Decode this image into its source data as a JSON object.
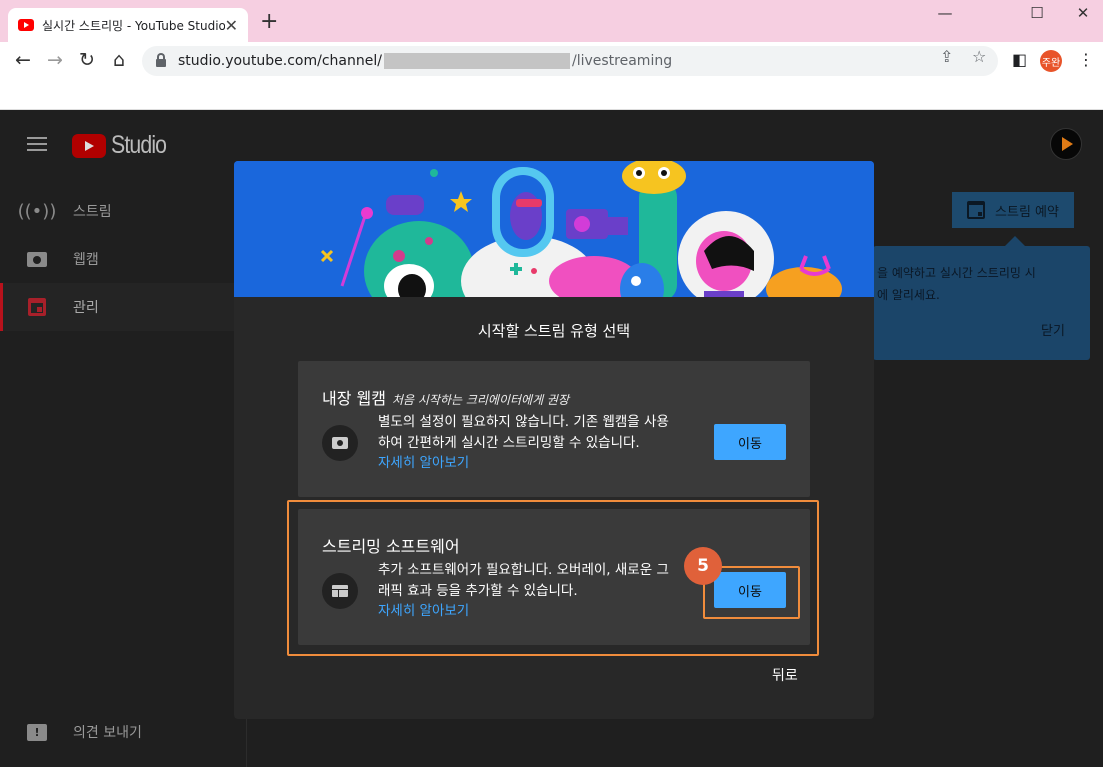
{
  "browser": {
    "tab_title": "실시간 스트리밍 - YouTube Studio",
    "tab_close": "✕",
    "new_tab": "+",
    "window_controls": {
      "minimize": "—",
      "maximize": "☐",
      "close": "✕"
    },
    "url_prefix": "studio.youtube.com/channel/",
    "url_suffix": "/livestreaming",
    "profile_label": "주완"
  },
  "studio": {
    "logo_text": "Studio",
    "sidebar": {
      "items": [
        {
          "label": "스트림",
          "icon": "live-stream-icon"
        },
        {
          "label": "웹캠",
          "icon": "camera-icon"
        },
        {
          "label": "관리",
          "icon": "calendar-icon",
          "active": true
        }
      ],
      "feedback_label": "의견 보내기"
    },
    "schedule_button": "스트림 예약",
    "tooltip": {
      "line1": "을 예약하고 실시간 스트리밍 시",
      "line2": "에 알리세요.",
      "close": "닫기"
    }
  },
  "dialog": {
    "title": "시작할 스트림 유형 선택",
    "options": [
      {
        "title": "내장 웹캠",
        "subtitle": "처음 시작하는 크리에이터에게 권장",
        "desc1": "별도의 설정이 필요하지 않습니다. 기존 웹캠을 사용",
        "desc2": "하여 간편하게 실시간 스트리밍할 수 있습니다.",
        "learn_more": "자세히 알아보기",
        "button": "이동",
        "icon": "camera-icon"
      },
      {
        "title": "스트리밍 소프트웨어",
        "desc1": "추가 소프트웨어가 필요합니다. 오버레이, 새로운 그",
        "desc2": "래픽 효과 등을 추가할 수 있습니다.",
        "learn_more": "자세히 알아보기",
        "button": "이동",
        "icon": "software-layout-icon"
      }
    ],
    "back": "뒤로"
  },
  "annotation": {
    "step": "5",
    "color": "#f08c3c"
  }
}
